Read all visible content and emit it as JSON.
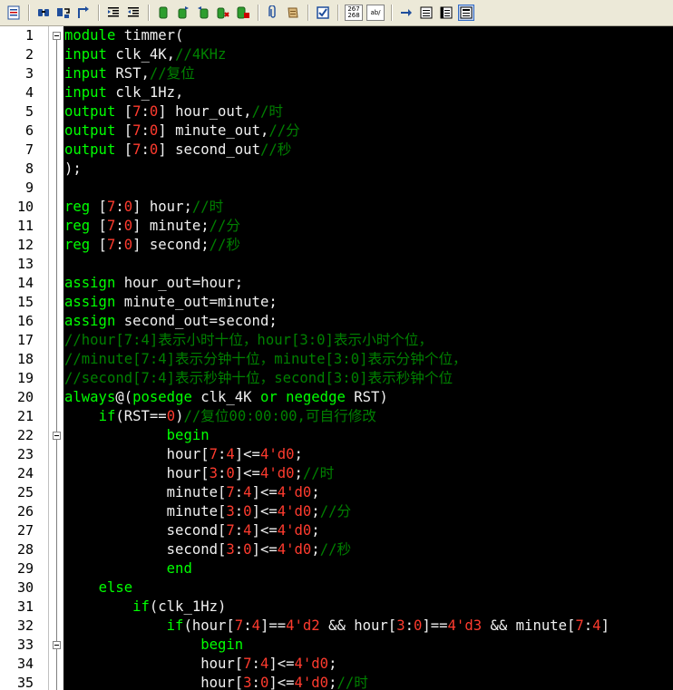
{
  "toolbar": {
    "buttons": [
      {
        "name": "document-list-icon"
      },
      {
        "sep": true
      },
      {
        "name": "find-icon"
      },
      {
        "name": "replace-icon"
      },
      {
        "name": "goto-icon"
      },
      {
        "sep": true
      },
      {
        "name": "indent-icon"
      },
      {
        "name": "unindent-icon"
      },
      {
        "sep": true
      },
      {
        "name": "bookmark-icon"
      },
      {
        "name": "bookmark-next-icon"
      },
      {
        "name": "bookmark-prev-icon"
      },
      {
        "name": "bookmark-toggle-icon"
      },
      {
        "name": "bookmark-clear-icon"
      },
      {
        "sep": true
      },
      {
        "name": "paperclip-icon"
      },
      {
        "name": "scroll-icon"
      },
      {
        "sep": true
      },
      {
        "name": "spellcheck-icon"
      },
      {
        "sep": true
      },
      {
        "name": "numbers-icon",
        "text": "267 268"
      },
      {
        "name": "abc-icon",
        "text": "ab/"
      },
      {
        "sep": true
      },
      {
        "name": "arrow-right-icon"
      },
      {
        "name": "lines-a-icon"
      },
      {
        "name": "lines-b-icon"
      },
      {
        "name": "lines-c-icon",
        "pressed": true
      }
    ]
  },
  "editor": {
    "start_line": 1,
    "lines": [
      [
        [
          "kw",
          "module"
        ],
        [
          "pl",
          " timmer("
        ]
      ],
      [
        [
          "kw",
          "input"
        ],
        [
          "pl",
          " clk_4K,"
        ],
        [
          "cm",
          "//4KHz"
        ]
      ],
      [
        [
          "kw",
          "input"
        ],
        [
          "pl",
          " RST,"
        ],
        [
          "cm",
          "//复位"
        ]
      ],
      [
        [
          "kw",
          "input"
        ],
        [
          "pl",
          " clk_1Hz,"
        ]
      ],
      [
        [
          "kw",
          "output"
        ],
        [
          "pl",
          " ["
        ],
        [
          "num",
          "7"
        ],
        [
          "pl",
          ":"
        ],
        [
          "num",
          "0"
        ],
        [
          "pl",
          "] hour_out,"
        ],
        [
          "cm",
          "//时"
        ]
      ],
      [
        [
          "kw",
          "output"
        ],
        [
          "pl",
          " ["
        ],
        [
          "num",
          "7"
        ],
        [
          "pl",
          ":"
        ],
        [
          "num",
          "0"
        ],
        [
          "pl",
          "] minute_out,"
        ],
        [
          "cm",
          "//分"
        ]
      ],
      [
        [
          "kw",
          "output"
        ],
        [
          "pl",
          " ["
        ],
        [
          "num",
          "7"
        ],
        [
          "pl",
          ":"
        ],
        [
          "num",
          "0"
        ],
        [
          "pl",
          "] second_out"
        ],
        [
          "cm",
          "//秒"
        ]
      ],
      [
        [
          "pl",
          ");"
        ]
      ],
      [
        [
          "pl",
          ""
        ]
      ],
      [
        [
          "kw",
          "reg"
        ],
        [
          "pl",
          " ["
        ],
        [
          "num",
          "7"
        ],
        [
          "pl",
          ":"
        ],
        [
          "num",
          "0"
        ],
        [
          "pl",
          "] hour;"
        ],
        [
          "cm",
          "//时"
        ]
      ],
      [
        [
          "kw",
          "reg"
        ],
        [
          "pl",
          " ["
        ],
        [
          "num",
          "7"
        ],
        [
          "pl",
          ":"
        ],
        [
          "num",
          "0"
        ],
        [
          "pl",
          "] minute;"
        ],
        [
          "cm",
          "//分"
        ]
      ],
      [
        [
          "kw",
          "reg"
        ],
        [
          "pl",
          " ["
        ],
        [
          "num",
          "7"
        ],
        [
          "pl",
          ":"
        ],
        [
          "num",
          "0"
        ],
        [
          "pl",
          "] second;"
        ],
        [
          "cm",
          "//秒"
        ]
      ],
      [
        [
          "pl",
          ""
        ]
      ],
      [
        [
          "kw",
          "assign"
        ],
        [
          "pl",
          " hour_out=hour;"
        ]
      ],
      [
        [
          "kw",
          "assign"
        ],
        [
          "pl",
          " minute_out=minute;"
        ]
      ],
      [
        [
          "kw",
          "assign"
        ],
        [
          "pl",
          " second_out=second;"
        ]
      ],
      [
        [
          "cm",
          "//hour[7:4]表示小时十位，hour[3:0]表示小时个位，"
        ]
      ],
      [
        [
          "cm",
          "//minute[7:4]表示分钟十位，minute[3:0]表示分钟个位，"
        ]
      ],
      [
        [
          "cm",
          "//second[7:4]表示秒钟十位，second[3:0]表示秒钟个位"
        ]
      ],
      [
        [
          "kw",
          "always"
        ],
        [
          "pl",
          "@("
        ],
        [
          "kw",
          "posedge"
        ],
        [
          "pl",
          " clk_4K "
        ],
        [
          "kw",
          "or"
        ],
        [
          "pl",
          " "
        ],
        [
          "kw",
          "negedge"
        ],
        [
          "pl",
          " RST)"
        ]
      ],
      [
        [
          "pl",
          "    "
        ],
        [
          "kw",
          "if"
        ],
        [
          "pl",
          "(RST=="
        ],
        [
          "num",
          "0"
        ],
        [
          "pl",
          ")"
        ],
        [
          "cm",
          "//复位00:00:00,可自行修改"
        ]
      ],
      [
        [
          "pl",
          "            "
        ],
        [
          "kw",
          "begin"
        ]
      ],
      [
        [
          "pl",
          "            hour["
        ],
        [
          "num",
          "7"
        ],
        [
          "pl",
          ":"
        ],
        [
          "num",
          "4"
        ],
        [
          "pl",
          "]<="
        ],
        [
          "num",
          "4'd0"
        ],
        [
          "pl",
          ";"
        ]
      ],
      [
        [
          "pl",
          "            hour["
        ],
        [
          "num",
          "3"
        ],
        [
          "pl",
          ":"
        ],
        [
          "num",
          "0"
        ],
        [
          "pl",
          "]<="
        ],
        [
          "num",
          "4'd0"
        ],
        [
          "pl",
          ";"
        ],
        [
          "cm",
          "//时"
        ]
      ],
      [
        [
          "pl",
          "            minute["
        ],
        [
          "num",
          "7"
        ],
        [
          "pl",
          ":"
        ],
        [
          "num",
          "4"
        ],
        [
          "pl",
          "]<="
        ],
        [
          "num",
          "4'd0"
        ],
        [
          "pl",
          ";"
        ]
      ],
      [
        [
          "pl",
          "            minute["
        ],
        [
          "num",
          "3"
        ],
        [
          "pl",
          ":"
        ],
        [
          "num",
          "0"
        ],
        [
          "pl",
          "]<="
        ],
        [
          "num",
          "4'd0"
        ],
        [
          "pl",
          ";"
        ],
        [
          "cm",
          "//分"
        ]
      ],
      [
        [
          "pl",
          "            second["
        ],
        [
          "num",
          "7"
        ],
        [
          "pl",
          ":"
        ],
        [
          "num",
          "4"
        ],
        [
          "pl",
          "]<="
        ],
        [
          "num",
          "4'd0"
        ],
        [
          "pl",
          ";"
        ]
      ],
      [
        [
          "pl",
          "            second["
        ],
        [
          "num",
          "3"
        ],
        [
          "pl",
          ":"
        ],
        [
          "num",
          "0"
        ],
        [
          "pl",
          "]<="
        ],
        [
          "num",
          "4'd0"
        ],
        [
          "pl",
          ";"
        ],
        [
          "cm",
          "//秒"
        ]
      ],
      [
        [
          "pl",
          "            "
        ],
        [
          "kw",
          "end"
        ]
      ],
      [
        [
          "pl",
          "    "
        ],
        [
          "kw",
          "else"
        ]
      ],
      [
        [
          "pl",
          "        "
        ],
        [
          "kw",
          "if"
        ],
        [
          "pl",
          "(clk_1Hz)"
        ]
      ],
      [
        [
          "pl",
          "            "
        ],
        [
          "kw",
          "if"
        ],
        [
          "pl",
          "(hour["
        ],
        [
          "num",
          "7"
        ],
        [
          "pl",
          ":"
        ],
        [
          "num",
          "4"
        ],
        [
          "pl",
          "]=="
        ],
        [
          "num",
          "4'd2"
        ],
        [
          "pl",
          " && hour["
        ],
        [
          "num",
          "3"
        ],
        [
          "pl",
          ":"
        ],
        [
          "num",
          "0"
        ],
        [
          "pl",
          "]=="
        ],
        [
          "num",
          "4'd3"
        ],
        [
          "pl",
          " && minute["
        ],
        [
          "num",
          "7"
        ],
        [
          "pl",
          ":"
        ],
        [
          "num",
          "4"
        ],
        [
          "pl",
          "]"
        ]
      ],
      [
        [
          "pl",
          "                "
        ],
        [
          "kw",
          "begin"
        ]
      ],
      [
        [
          "pl",
          "                hour["
        ],
        [
          "num",
          "7"
        ],
        [
          "pl",
          ":"
        ],
        [
          "num",
          "4"
        ],
        [
          "pl",
          "]<="
        ],
        [
          "num",
          "4'd0"
        ],
        [
          "pl",
          ";"
        ]
      ],
      [
        [
          "pl",
          "                hour["
        ],
        [
          "num",
          "3"
        ],
        [
          "pl",
          ":"
        ],
        [
          "num",
          "0"
        ],
        [
          "pl",
          "]<="
        ],
        [
          "num",
          "4'd0"
        ],
        [
          "pl",
          ";"
        ],
        [
          "cm",
          "//时"
        ]
      ]
    ],
    "fold_markers": [
      1,
      22,
      33
    ]
  }
}
